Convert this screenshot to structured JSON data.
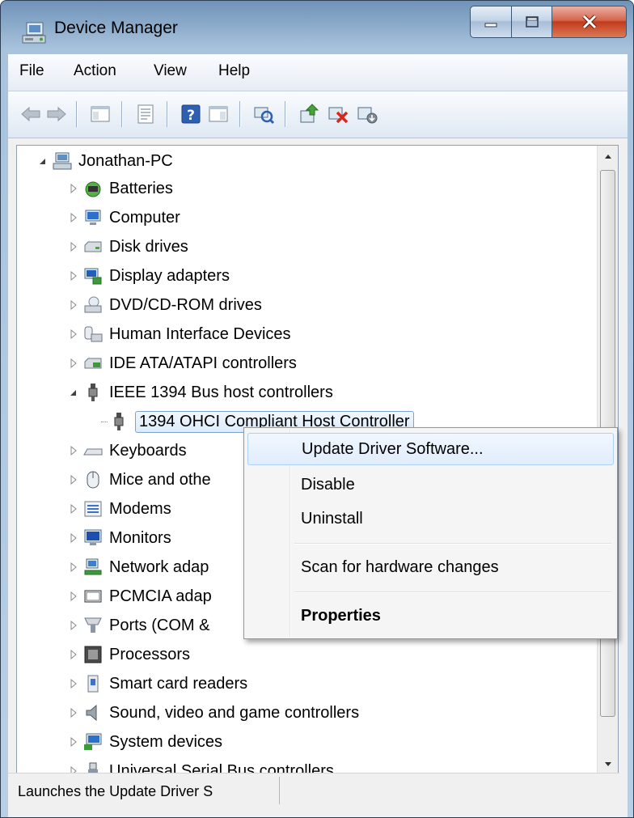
{
  "window": {
    "title": "Device Manager"
  },
  "menu": {
    "items": [
      "File",
      "Action",
      "View",
      "Help"
    ]
  },
  "toolbar": {
    "buttons": [
      "back-icon",
      "forward-icon",
      "show-hide-tree-icon",
      "properties-icon",
      "help-icon",
      "action-pane-icon",
      "scan-hardware-icon",
      "update-driver-icon",
      "uninstall-icon",
      "disable-icon"
    ]
  },
  "tree": {
    "root": "Jonathan-PC",
    "categories": [
      "Batteries",
      "Computer",
      "Disk drives",
      "Display adapters",
      "DVD/CD-ROM drives",
      "Human Interface Devices",
      "IDE ATA/ATAPI controllers",
      "IEEE 1394 Bus host controllers",
      "1394 OHCI Compliant Host Controller",
      "Keyboards",
      "Mice and othe",
      "Modems",
      "Monitors",
      "Network adap",
      "PCMCIA adap",
      "Ports (COM &",
      "Processors",
      "Smart card readers",
      "Sound, video and game controllers",
      "System devices",
      "Universal Serial Bus controllers"
    ]
  },
  "context_menu": {
    "items": [
      {
        "label": "Update Driver Software...",
        "highlighted": true
      },
      {
        "label": "Disable"
      },
      {
        "label": "Uninstall"
      },
      {
        "label": "Scan for hardware changes"
      },
      {
        "label": "Properties",
        "bold": true
      }
    ]
  },
  "status": {
    "text": "Launches the Update Driver S"
  },
  "colors": {
    "selection_border": "#7da2ce",
    "menu_highlight": "#e0edfc",
    "close_button": "#c23b1c",
    "uninstall_red": "#d9261c"
  }
}
